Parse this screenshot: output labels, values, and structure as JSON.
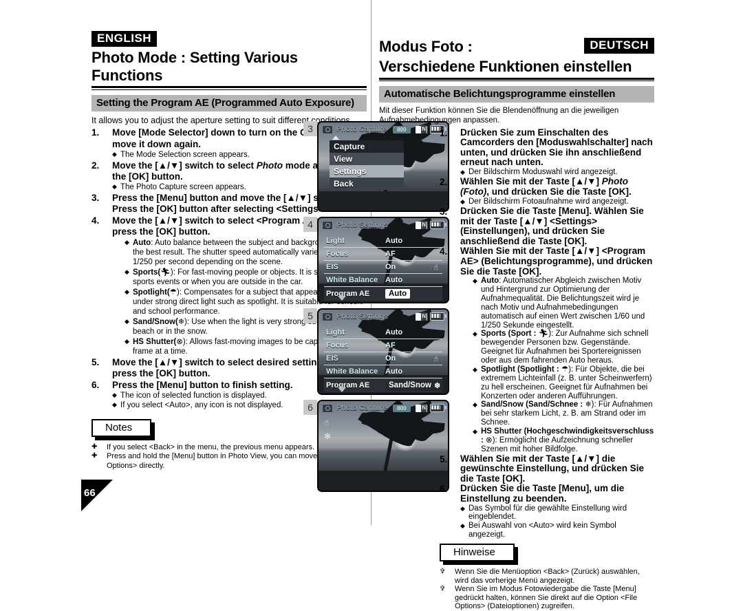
{
  "layout": {
    "page_number": "66"
  },
  "english": {
    "lang_tag": "ENGLISH",
    "title_line1": "Photo Mode : Setting Various Functions",
    "section_bar": "Setting the Program AE (Programmed Auto Exposure)",
    "intro": "It allows you to adjust the aperture setting to suit different conditions.",
    "steps": [
      {
        "num": "1.",
        "text": "Move [Mode Selector] down to turn on the CAM and move it down again.",
        "bullets": [
          "The Mode Selection screen appears."
        ]
      },
      {
        "num": "2.",
        "text_pre": "Move the [▲/▼] switch to select ",
        "text_ital": "Photo",
        "text_post": " mode and press the [OK] button.",
        "bullets": [
          "The Photo Capture screen appears."
        ]
      },
      {
        "num": "3.",
        "text": "Press the [Menu] button and move the [▲/▼] switch. Press the [OK] button after selecting <Settings>.",
        "bullets": []
      },
      {
        "num": "4.",
        "text": "Move the [▲/▼] switch to select <Program AE> and press the [OK] button.",
        "bullets": []
      }
    ],
    "mode_bullets": [
      {
        "name": "Auto",
        "icon": "",
        "text": ": Auto balance between the subject and background to get the best result. The shutter speed automatically varies from 1/60 to 1/250 per second depending on the scene."
      },
      {
        "name": "Sports",
        "icon": "sports-runner-icon",
        "text": "): For fast-moving people or objects. It is suitable for sports events or when you are outside in the car."
      },
      {
        "name": "Spotlight",
        "icon": "spotlight-icon",
        "text": "): Compensates for a subject that appears too bright under strong direct light such as spotlight. It is suitable for concert and school performance."
      },
      {
        "name": "Sand/Snow",
        "icon": "snowflake-icon",
        "text": "): Use when the light is very strong such as on the beach or in the snow."
      },
      {
        "name": "HS Shutter",
        "icon": "hs-shutter-icon",
        "text": "): Allows fast-moving images to be captured one frame at a time."
      }
    ],
    "steps_tail": [
      {
        "num": "5.",
        "text": "Move the [▲/▼] switch to select desired setting and press the [OK] button.",
        "bullets": []
      },
      {
        "num": "6.",
        "text": "Press the [Menu] button to finish setting.",
        "bullets": [
          "The icon of selected function is displayed.",
          "If you select <Auto>, any icon is not displayed."
        ]
      }
    ],
    "notes_label": "Notes",
    "notes": [
      "If you select <Back> in the menu, the previous menu appears.",
      "Press and hold the [Menu] button in Photo View, you can move to <File Options> directly."
    ]
  },
  "german": {
    "lang_tag": "DEUTSCH",
    "title_line1": "Modus Foto :",
    "title_line2": "Verschiedene Funktionen einstellen",
    "section_bar": "Automatische Belichtungsprogramme einstellen",
    "intro": "Mit dieser Funktion können Sie die Blendenöffnung an die jeweiligen Aufnahmebedingungen anpassen.",
    "steps": [
      {
        "num": "1.",
        "text": "Drücken Sie zum Einschalten des Camcorders den [Moduswahlschalter] nach unten, und drücken Sie ihn anschließend erneut nach unten.",
        "bullets": [
          "Der Bildschirm Moduswahl wird angezeigt."
        ]
      },
      {
        "num": "2.",
        "text_pre": "Wählen Sie mit der Taste [▲/▼] ",
        "text_ital": "Photo (Foto)",
        "text_post": ", und drücken Sie die Taste [OK].",
        "bullets": [
          "Der Bildschirm Fotoaufnahme wird angezeigt."
        ]
      },
      {
        "num": "3.",
        "text": "Drücken Sie die Taste [Menu]. Wählen Sie mit der Taste [▲/▼] <Settings> (Einstellungen), und drücken Sie anschließend die Taste [OK].",
        "bullets": []
      },
      {
        "num": "4.",
        "text": "Wählen Sie mit der Taste [▲/▼] <Program AE> (Belichtungsprogramme), und drücken Sie die Taste [OK].",
        "bullets": []
      }
    ],
    "mode_bullets": [
      {
        "name": "Auto",
        "icon": "",
        "text": ": Automatischer Abgleich zwischen Motiv und Hintergrund  zur Optimierung der Aufnahmequalität. Die Belichtungszeit wird je nach Motiv und Aufnahmebedingungen automatisch auf einen Wert zwischen 1/60 und 1/250 Sekunde eingestellt."
      },
      {
        "name": "Sports (Sport :",
        "icon": "sports-runner-icon",
        "text": "): Zur Aufnahme sich schnell bewegender Personen bzw. Gegenstände. Geeignet für Aufnahmen bei Sportereignissen oder aus dem fahrenden Auto heraus."
      },
      {
        "name": "Spotlight (Spotlight :",
        "icon": "spotlight-icon",
        "text": "): Für Objekte, die bei extremem Lichteinfall (z. B. unter Scheinwerfern) zu hell erscheinen. Geeignet für Aufnahmen bei Konzerten oder anderen Aufführungen."
      },
      {
        "name": "Sand/Snow (Sand/Schnee :",
        "icon": "snowflake-icon",
        "text": "): Für Aufnahmen bei sehr starkem Licht, z. B. am Strand oder im Schnee."
      },
      {
        "name": "HS Shutter (Hochgeschwindigkeitsverschluss :",
        "icon": "hs-shutter-icon",
        "text": "): Ermöglicht die Aufzeichnung schneller Szenen mit hoher Bildfolge."
      }
    ],
    "steps_tail": [
      {
        "num": "5.",
        "text": "Wählen Sie mit der Taste [▲/▼] die gewünschte Einstellung, und drücken Sie die Taste [OK].",
        "bullets": []
      },
      {
        "num": "6.",
        "text": "Drücken Sie die Taste [Menu], um die Einstellung zu beenden.",
        "bullets": [
          "Das Symbol für die gewählte Einstellung wird eingeblendet.",
          "Bei Auswahl von <Auto> wird kein Symbol angezeigt."
        ]
      }
    ],
    "notes_label": "Hinweise",
    "notes": [
      "Wenn Sie die Menüoption <Back> (Zurück) auswählen, wird das vorherige Menü angezeigt.",
      "Wenn Sie im Modus Fotowiedergabe die Taste [Menu] gedrückt halten, können Sie direkt auf die Option <File Options> (Dateioptionen) zugreifen."
    ]
  },
  "screens": [
    {
      "badge": "3",
      "title": "Photo Capture",
      "pixels": "800",
      "menu_items": [
        "Capture",
        "View",
        "Settings",
        "Back"
      ]
    },
    {
      "badge": "4",
      "title": "Photo Settings",
      "rows": [
        {
          "label": "Light",
          "value": "Auto"
        },
        {
          "label": "Focus",
          "value": "AF"
        },
        {
          "label": "EIS",
          "value": "On"
        },
        {
          "label": "White Balance",
          "value": "Auto"
        }
      ],
      "selected_row": {
        "label": "Program AE",
        "value": "Auto"
      }
    },
    {
      "badge": "5",
      "title": "Photo Settings",
      "rows": [
        {
          "label": "Light",
          "value": "Auto"
        },
        {
          "label": "Focus",
          "value": "AF"
        },
        {
          "label": "EIS",
          "value": "On"
        },
        {
          "label": "White Balance",
          "value": "Auto"
        }
      ],
      "selected_row": {
        "label": "Program AE",
        "value": "Sand/Snow"
      }
    },
    {
      "badge": "6",
      "title": "Photo Capture",
      "pixels": "800",
      "overlay_icons": [
        "hand-icon",
        "snowflake-icon"
      ]
    }
  ]
}
